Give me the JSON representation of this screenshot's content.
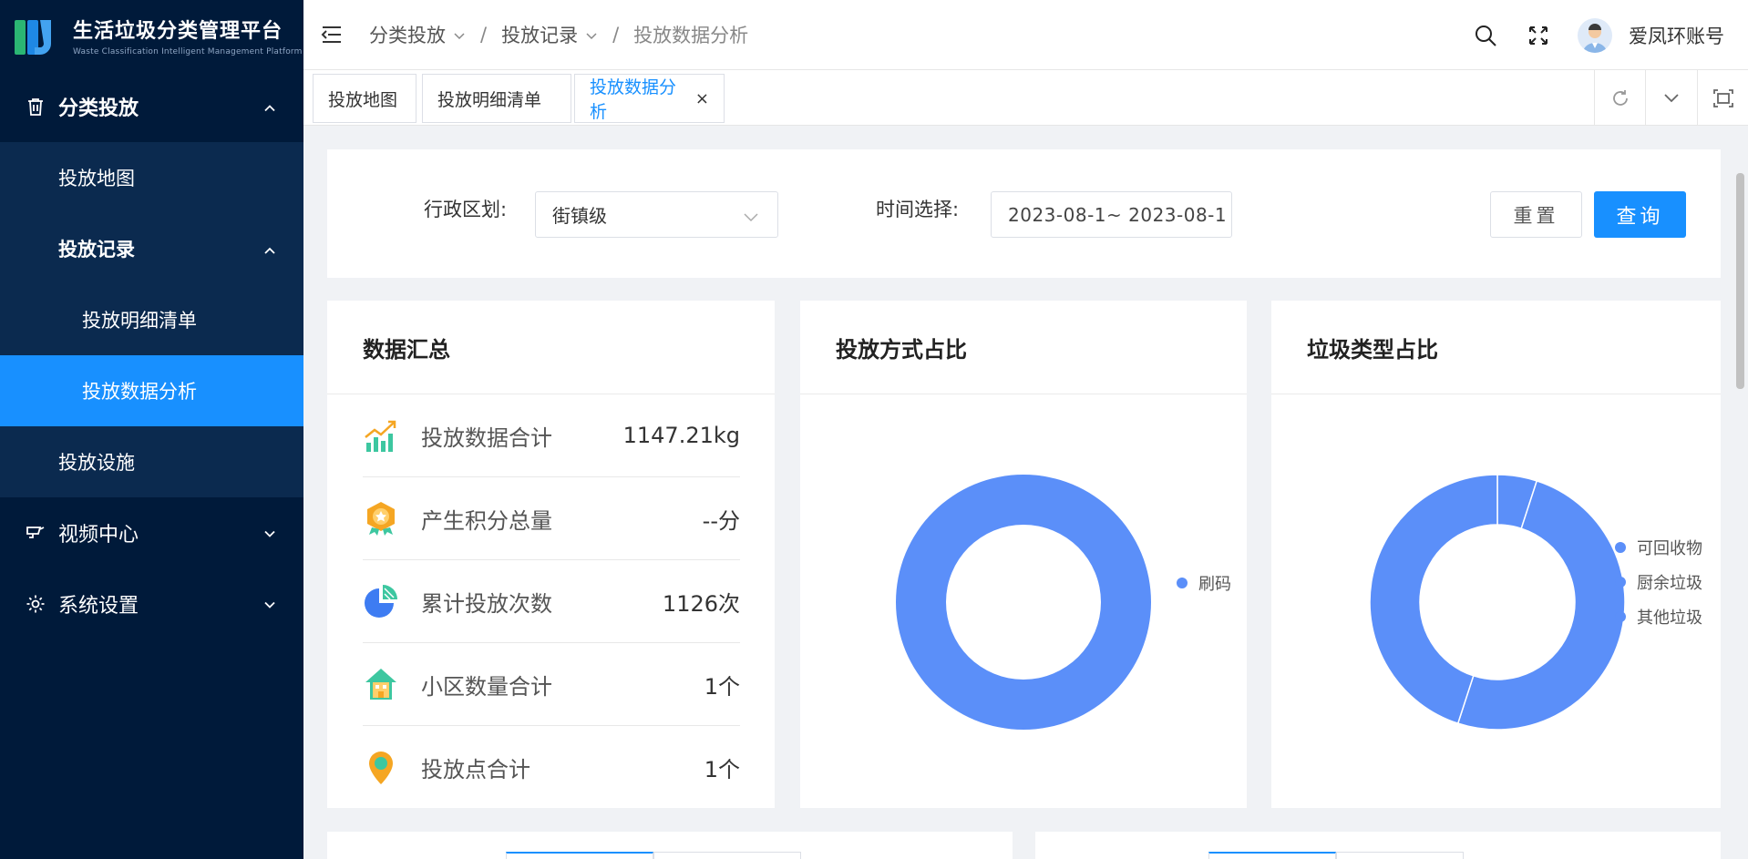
{
  "app": {
    "title": "生活垃圾分类管理平台",
    "subtitle": "Waste Classification Intelligent Management Platform"
  },
  "sidebar": {
    "items": [
      {
        "label": "分类投放",
        "icon": "trash-icon",
        "expanded": true
      },
      {
        "label": "投放地图"
      },
      {
        "label": "投放记录",
        "expanded": true
      },
      {
        "label": "投放明细清单"
      },
      {
        "label": "投放数据分析",
        "active": true
      },
      {
        "label": "投放设施"
      },
      {
        "label": "视频中心",
        "icon": "camera-icon"
      },
      {
        "label": "系统设置",
        "icon": "gear-icon"
      }
    ]
  },
  "header": {
    "breadcrumb": [
      "分类投放",
      "投放记录",
      "投放数据分析"
    ],
    "username": "爱凤环账号"
  },
  "tags": [
    "投放地图",
    "投放明细清单",
    "投放数据分析"
  ],
  "tag_close": "×",
  "filter": {
    "region_label": "行政区划:",
    "region_value": "街镇级",
    "time_label": "时间选择:",
    "date_range": "2023-08-1~ 2023-08-1",
    "reset": "重置",
    "query": "查询"
  },
  "summary": {
    "title": "数据汇总",
    "rows": [
      {
        "label": "投放数据合计",
        "value": "1147.21kg",
        "icon": "trend-chart-icon"
      },
      {
        "label": "产生积分总量",
        "value": "--分",
        "icon": "medal-icon"
      },
      {
        "label": "累计投放次数",
        "value": "1126次",
        "icon": "pie-icon"
      },
      {
        "label": "小区数量合计",
        "value": "1个",
        "icon": "house-icon"
      },
      {
        "label": "投放点合计",
        "value": "1个",
        "icon": "location-pin-icon"
      }
    ]
  },
  "chart_data": [
    {
      "type": "pie",
      "title": "投放方式占比",
      "categories": [
        "刷码"
      ],
      "values": [
        100
      ],
      "colors": [
        "#5b8ff9"
      ]
    },
    {
      "type": "pie",
      "title": "垃圾类型占比",
      "categories": [
        "可回收物",
        "厨余垃圾",
        "其他垃圾"
      ],
      "values": [
        5,
        50,
        45
      ],
      "colors": [
        "#5b8ff9",
        "#5b8ff9",
        "#5b8ff9"
      ]
    }
  ],
  "colors": {
    "sidebar_bg": "#001a3a",
    "sidebar_sub_bg": "#0b2a4f",
    "accent": "#1890ff",
    "chart": "#5b8ff9"
  }
}
